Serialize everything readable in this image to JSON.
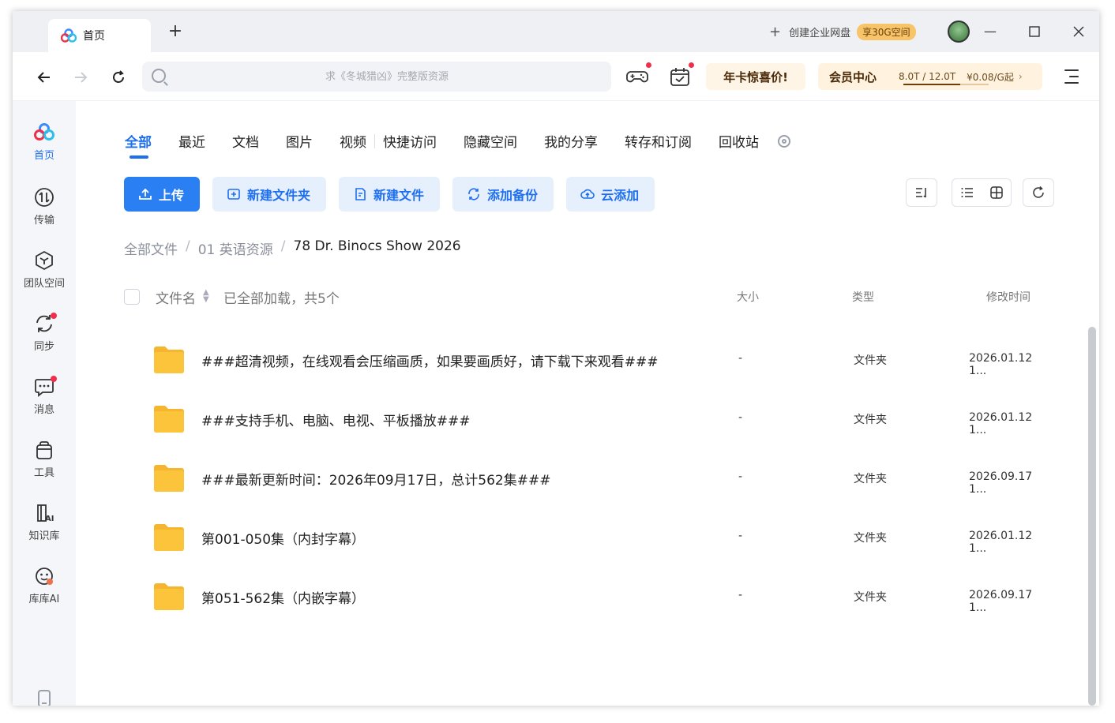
{
  "tab": {
    "label": "首页"
  },
  "titlebar": {
    "create_label": "创建企业网盘",
    "promo": "享30G空间"
  },
  "search": {
    "placeholder": "求《冬城猎凶》完整版资源"
  },
  "promo_buttons": {
    "annual": "年卡惊喜价!",
    "vip": "会员中心",
    "quota": "8.0T / 12.0T",
    "quota_fraction": 0.67,
    "price": "¥0.08/G起"
  },
  "sidebar": {
    "items": [
      {
        "label": "首页",
        "icon": "home-logo-icon"
      },
      {
        "label": "传输",
        "icon": "transfer-icon"
      },
      {
        "label": "团队空间",
        "icon": "team-space-icon"
      },
      {
        "label": "同步",
        "icon": "sync-icon"
      },
      {
        "label": "消息",
        "icon": "message-icon"
      },
      {
        "label": "工具",
        "icon": "tools-icon"
      },
      {
        "label": "知识库",
        "icon": "knowledge-base-icon"
      },
      {
        "label": "库库AI",
        "icon": "kuku-ai-icon"
      }
    ]
  },
  "filters": [
    "全部",
    "最近",
    "文档",
    "图片",
    "视频",
    "快捷访问",
    "隐藏空间",
    "我的分享",
    "转存和订阅",
    "回收站"
  ],
  "actions": {
    "upload": "上传",
    "new_folder": "新建文件夹",
    "new_file": "新建文件",
    "add_backup": "添加备份",
    "cloud_add": "云添加"
  },
  "breadcrumb": {
    "root": "全部文件",
    "parent": "01 英语资源",
    "current": "78 Dr. Binocs Show 2026",
    "sep": "/"
  },
  "list_header": {
    "name": "文件名",
    "loaded": "已全部加载，共5个",
    "size": "大小",
    "type": "类型",
    "mtime": "修改时间"
  },
  "files": [
    {
      "name": "###超清视频，在线观看会压缩画质，如果要画质好，请下载下来观看###",
      "size": "-",
      "type": "文件夹",
      "mtime": "2026.01.12 1..."
    },
    {
      "name": "###支持手机、电脑、电视、平板播放###",
      "size": "-",
      "type": "文件夹",
      "mtime": "2026.01.12 1..."
    },
    {
      "name": "###最新更新时间：2026年09月17日，总计562集###",
      "size": "-",
      "type": "文件夹",
      "mtime": "2026.09.17 1..."
    },
    {
      "name": "第001-050集（内封字幕）",
      "size": "-",
      "type": "文件夹",
      "mtime": "2026.01.12 1..."
    },
    {
      "name": "第051-562集（内嵌字幕）",
      "size": "-",
      "type": "文件夹",
      "mtime": "2026.09.17 1..."
    }
  ],
  "colors": {
    "accent": "#2a7ff2",
    "accent_light": "#e6f0fd",
    "folder": "#fcc43a",
    "badge_red": "#f0304a"
  }
}
